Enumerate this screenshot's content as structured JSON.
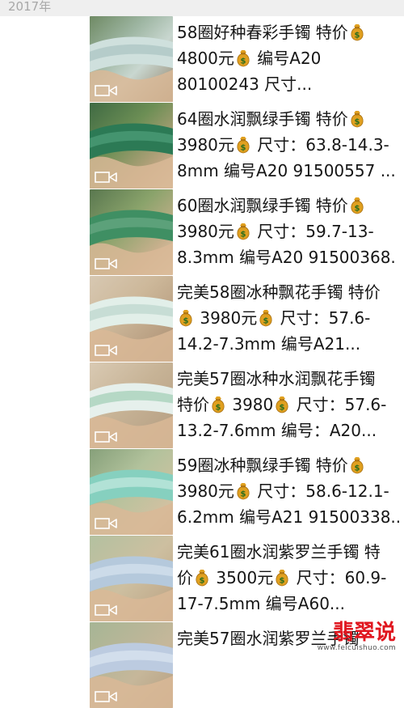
{
  "header": {
    "year_label": "2017年"
  },
  "icons": {
    "money_bag": "money-bag-icon",
    "video": "video-camera-icon"
  },
  "colors": {
    "money_bag": "#e0a020",
    "watermark": "#e0161f"
  },
  "items": [
    {
      "lines": [
        [
          "58圈好种春彩手镯 特价",
          "$"
        ],
        [
          "4800元",
          "$",
          " 编号A20"
        ],
        [
          "80100243 尺寸..."
        ]
      ]
    },
    {
      "lines": [
        [
          "64圈水润飘绿手镯 特价",
          "$"
        ],
        [
          "3980元",
          "$",
          " 尺寸：63.8-14.3-"
        ],
        [
          "8mm 编号A20 91500557 ..."
        ]
      ]
    },
    {
      "lines": [
        [
          "60圈水润飘绿手镯 特价",
          "$"
        ],
        [
          "3980元",
          "$",
          " 尺寸：59.7-13-"
        ],
        [
          "8.3mm 编号A20 91500368."
        ]
      ]
    },
    {
      "lines": [
        [
          "完美58圈冰种飘花手镯 特价"
        ],
        [
          "$",
          " 3980元",
          "$",
          " 尺寸：57.6-"
        ],
        [
          "14.2-7.3mm 编号A21..."
        ]
      ]
    },
    {
      "lines": [
        [
          "完美57圈冰种水润飘花手镯"
        ],
        [
          "特价",
          "$",
          " 3980",
          "$",
          " 尺寸：57.6-"
        ],
        [
          "13.2-7.6mm 编号：A20..."
        ]
      ]
    },
    {
      "lines": [
        [
          "59圈冰种飘绿手镯 特价",
          "$"
        ],
        [
          "3980元",
          "$",
          " 尺寸：58.6-12.1-"
        ],
        [
          "6.2mm 编号A21 91500338..."
        ]
      ]
    },
    {
      "lines": [
        [
          "完美61圈水润紫罗兰手镯 特"
        ],
        [
          "价",
          "$",
          " 3500元",
          "$",
          " 尺寸：60.9-"
        ],
        [
          "17-7.5mm 编号A60..."
        ]
      ]
    },
    {
      "lines": [
        [
          "完美57圈水润紫罗兰手镯"
        ]
      ]
    }
  ],
  "watermark": {
    "title": "翡翠说",
    "url": "www.feicuishuo.com"
  }
}
